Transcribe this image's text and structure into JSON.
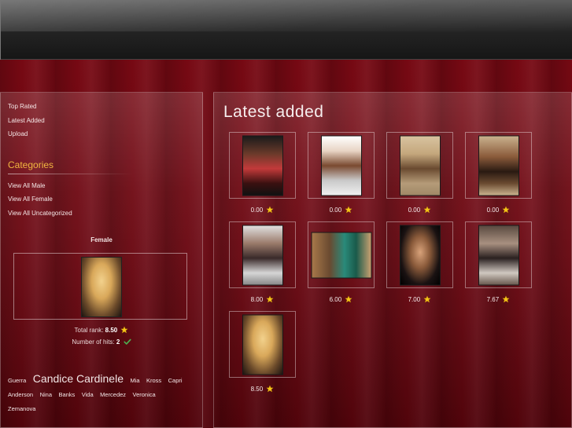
{
  "nav": {
    "top_rated": "Top Rated",
    "latest_added": "Latest Added",
    "upload": "Upload"
  },
  "categories": {
    "title": "Categories",
    "items": [
      "View All Male",
      "View All Female",
      "View All Uncategorized"
    ]
  },
  "featured": {
    "title": "Female",
    "total_rank_label": "Total rank:",
    "total_rank_value": "8.50",
    "hits_label": "Number of hits:",
    "hits_value": "2"
  },
  "tags": [
    "Guerra",
    "Candice Cardinele",
    "Mia",
    "Kross",
    "Capri",
    "Anderson",
    "Nina",
    "Banks",
    "Vida",
    "Mercedez",
    "Veronica",
    "Zemanova"
  ],
  "main": {
    "title": "Latest added",
    "items": [
      {
        "score": "0.00"
      },
      {
        "score": "0.00"
      },
      {
        "score": "0.00"
      },
      {
        "score": "0.00"
      },
      {
        "score": "8.00"
      },
      {
        "score": "6.00"
      },
      {
        "score": "7.00"
      },
      {
        "score": "7.67"
      },
      {
        "score": "8.50"
      }
    ]
  },
  "colors": {
    "accent": "#f0b640",
    "background": "#6a0610",
    "star": "#f5c518",
    "check": "#4caf50"
  }
}
